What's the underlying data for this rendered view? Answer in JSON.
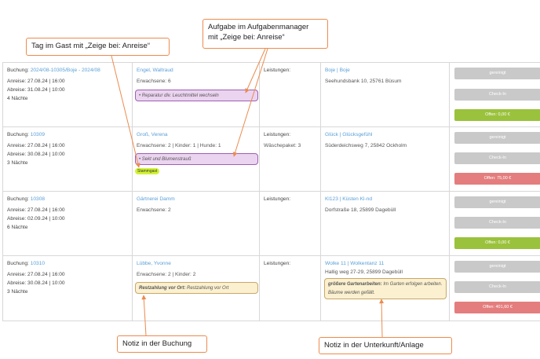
{
  "callouts": {
    "guest_tag": "Tag im Gast mit „Zeige bei: Anreise“",
    "task_manager_line1": "Aufgabe im Aufgabenmanager",
    "task_manager_line2": "mit „Zeige bei: Anreise“",
    "booking_note": "Notiz in der Buchung",
    "unit_note": "Notiz in der Unterkunft/Anlage"
  },
  "rows": [
    {
      "booking_label": "Buchung:",
      "booking_id": "2024/08-10305/Boje - 2024/08",
      "arrival": "Anreise: 27.08.24 | 16:00",
      "departure": "Abreise: 31.08.24 | 10:00",
      "nights": "4 Nächte",
      "guest": "Engel, Waltraud",
      "persons": "Erwachsene: 6",
      "task": "Reparatur div. Leuchtmittel wechseln",
      "services_label": "Leistungen:",
      "services": "",
      "unit": "Boje | Boje",
      "address": "Seehundsbank 10, 25761 Büsum",
      "btn1": "gereinigt",
      "btn2": "Check-In",
      "btn3": "Offen: 0,00 €"
    },
    {
      "booking_label": "Buchung:",
      "booking_id": "10309",
      "arrival": "Anreise: 27.08.24 | 16:00",
      "departure": "Abreise: 30.08.24 | 10:00",
      "nights": "3 Nächte",
      "guest": "Groß, Verena",
      "persons": "Erwachsene: 2 | Kinder: 1 | Hunde: 1",
      "task": "Sekt und Blumenstrauß",
      "tag": "Stammgast",
      "services_label": "Leistungen:",
      "services": "Wäschepaket: 3",
      "unit": "Glück | Glücksgefühl",
      "address": "Süderdeichsweg 7, 25842 Ockholm",
      "btn1": "gereinigt",
      "btn2": "Check-In",
      "btn3": "Offen: 75,00 €"
    },
    {
      "booking_label": "Buchung:",
      "booking_id": "10308",
      "arrival": "Anreise: 27.08.24 | 16:00",
      "departure": "Abreise: 02.09.24 | 10:00",
      "nights": "6 Nächte",
      "guest": "Gärtnerei Damm",
      "persons": "Erwachsene: 2",
      "services_label": "Leistungen:",
      "services": "",
      "unit": "Kl123 | Küsten Kl-nd",
      "address": "Dorfstraße 18, 25899 Dagebüll",
      "btn1": "gereinigt",
      "btn2": "Check-In",
      "btn3": "Offen: 0,00 €"
    },
    {
      "booking_label": "Buchung:",
      "booking_id": "10310",
      "arrival": "Anreise: 27.08.24 | 16:00",
      "departure": "Abreise: 30.08.24 | 10:00",
      "nights": "3 Nächte",
      "guest": "Lübbe, Yvonne",
      "persons": "Erwachsene: 2 | Kinder: 2",
      "note_bold": "Restzahlung vor Ort:",
      "note_text": " Restzahlung vor Ort",
      "services_label": "Leistungen:",
      "services": "",
      "unit": "Wolke 11 | Wolkentanz 11",
      "address": "Hallig weg 27-29, 25899 Dagebüll",
      "unit_note_bold": "größere Gartenarbeiten:",
      "unit_note_text": " Im Garten erfolgen arbeiten. Bäume werden gefällt.",
      "btn1": "gereinigt",
      "btn2": "Check-In",
      "btn3": "Offen: 401,60 €"
    }
  ],
  "colors": {
    "link": "#5aa0d8",
    "callout_border": "#ec8b4d",
    "task_bg": "#ebd4f0",
    "memo_bg": "#fbf0cf",
    "btn_grey": "#c9c9c9",
    "btn_green": "#9ac23c",
    "btn_red": "#e47d7d",
    "badge": "#d1f235"
  }
}
